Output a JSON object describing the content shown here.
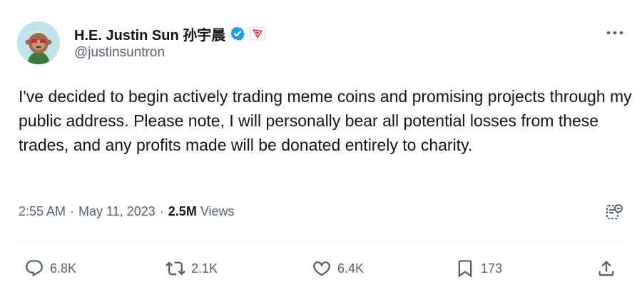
{
  "author": {
    "display_name": "H.E. Justin Sun 孙宇晨",
    "handle": "@justinsuntron",
    "avatar_icon": "ape-avatar",
    "verified_icon": "verified-badge-icon",
    "affiliate_icon": "tron-affiliate-badge-icon"
  },
  "tweet": {
    "text": "I've decided to begin actively trading meme coins and promising projects through my public address. Please note, I will personally bear all potential losses from these trades, and any profits made will be donated entirely to charity."
  },
  "meta": {
    "time": "2:55 AM",
    "separator1": "·",
    "date": "May 11, 2023",
    "separator2": "·",
    "views_count": "2.5M",
    "views_label": "Views"
  },
  "actions": {
    "reply_count": "6.8K",
    "retweet_count": "2.1K",
    "like_count": "6.4K",
    "bookmark_count": "173"
  },
  "colors": {
    "text": "#0f1419",
    "secondary": "#536471",
    "verified": "#1d9bf0",
    "divider": "#eff3f4"
  }
}
